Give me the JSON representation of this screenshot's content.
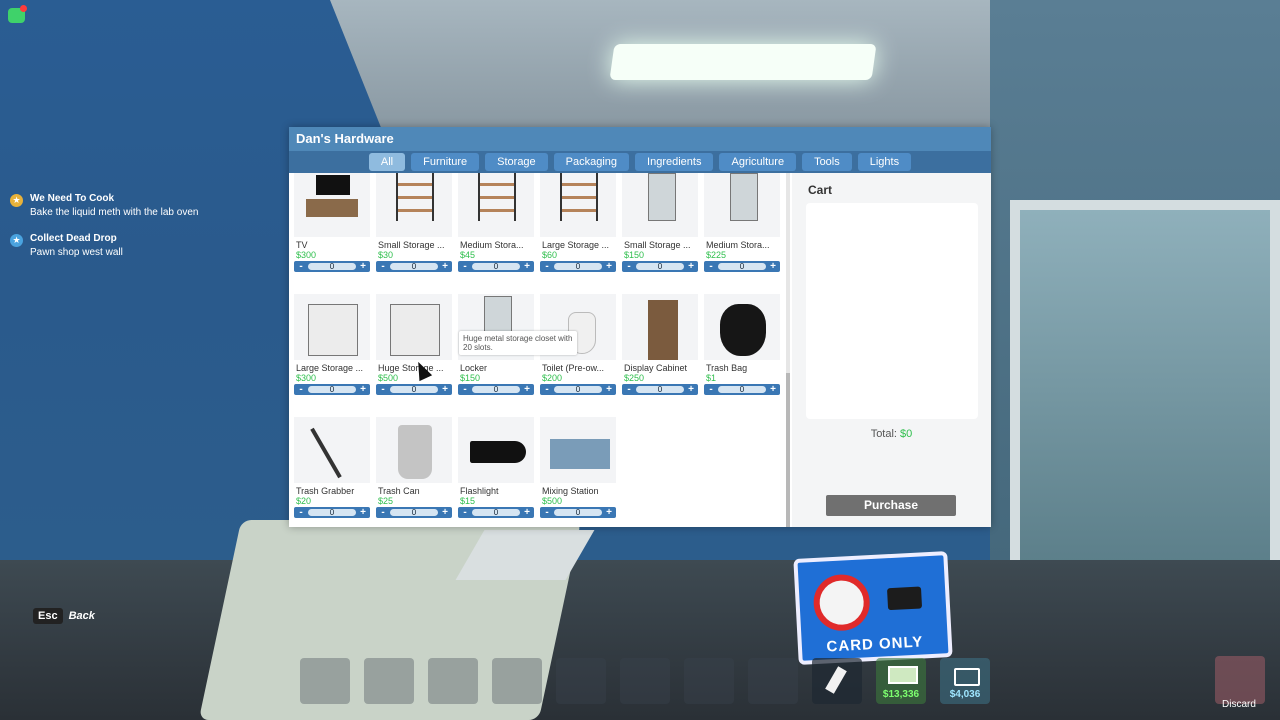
{
  "hud": {
    "quests": [
      {
        "title": "We Need To Cook",
        "desc": "Bake the liquid meth with the lab oven",
        "icon": "star-icon",
        "color": "#e8b23a"
      },
      {
        "title": "Collect Dead Drop",
        "desc": "Pawn shop west wall",
        "icon": "star-icon",
        "color": "#4aa3df"
      }
    ],
    "esc_key": "Esc",
    "esc_label": "Back",
    "cash": "$13,336",
    "online": "$4,036",
    "discard": "Discard",
    "sign_text": "CARD ONLY"
  },
  "shop": {
    "title": "Dan's Hardware",
    "tabs": [
      "All",
      "Furniture",
      "Storage",
      "Packaging",
      "Ingredients",
      "Agriculture",
      "Tools",
      "Lights"
    ],
    "active_tab": "All",
    "items": [
      {
        "name": "TV",
        "price": "$300",
        "qty": "0",
        "icon": "tv"
      },
      {
        "name": "Small Storage ...",
        "price": "$30",
        "qty": "0",
        "icon": "shelf"
      },
      {
        "name": "Medium Stora...",
        "price": "$45",
        "qty": "0",
        "icon": "shelf"
      },
      {
        "name": "Large Storage ...",
        "price": "$60",
        "qty": "0",
        "icon": "shelf"
      },
      {
        "name": "Small Storage ...",
        "price": "$150",
        "qty": "0",
        "icon": "locker"
      },
      {
        "name": "Medium Stora...",
        "price": "$225",
        "qty": "0",
        "icon": "locker"
      },
      {
        "name": "Large Storage ...",
        "price": "$300",
        "qty": "0",
        "icon": "wide-locker"
      },
      {
        "name": "Huge Storage ...",
        "price": "$500",
        "qty": "0",
        "icon": "wide-locker"
      },
      {
        "name": "Locker",
        "price": "$150",
        "qty": "0",
        "icon": "locker"
      },
      {
        "name": "Toilet (Pre-ow...",
        "price": "$200",
        "qty": "0",
        "icon": "toilet"
      },
      {
        "name": "Display Cabinet",
        "price": "$250",
        "qty": "0",
        "icon": "cabinet"
      },
      {
        "name": "Trash Bag",
        "price": "$1",
        "qty": "0",
        "icon": "bag"
      },
      {
        "name": "Trash Grabber",
        "price": "$20",
        "qty": "0",
        "icon": "grabber"
      },
      {
        "name": "Trash Can",
        "price": "$25",
        "qty": "0",
        "icon": "can"
      },
      {
        "name": "Flashlight",
        "price": "$15",
        "qty": "0",
        "icon": "flashlight"
      },
      {
        "name": "Mixing Station",
        "price": "$500",
        "qty": "0",
        "icon": "desk"
      }
    ],
    "tooltip": "Huge metal storage closet with 20 slots.",
    "cart_title": "Cart",
    "total_label": "Total:",
    "total_value": "$0",
    "purchase_label": "Purchase"
  }
}
